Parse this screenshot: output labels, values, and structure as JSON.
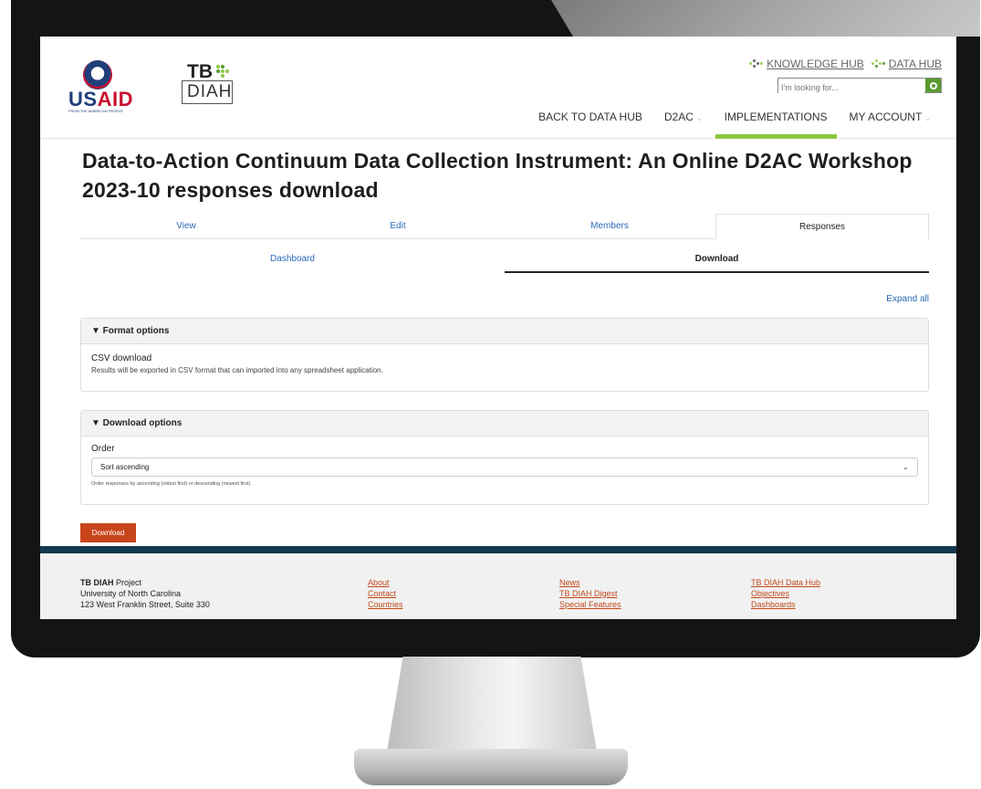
{
  "header": {
    "usaid": {
      "us": "US",
      "aid": "AID",
      "tagline": "FROM THE AMERICAN PEOPLE"
    },
    "tbdiah": {
      "tb": "TB",
      "diah": "DIAH"
    },
    "hub_links": [
      {
        "label": "KNOWLEDGE HUB",
        "icon": "hub-dots-icon"
      },
      {
        "label": "DATA HUB",
        "icon": "hub-dots-icon"
      }
    ],
    "search": {
      "placeholder": "I'm looking for..."
    },
    "nav": [
      {
        "label": "BACK TO DATA HUB"
      },
      {
        "label": "D2AC",
        "caret": "⌄"
      },
      {
        "label": "IMPLEMENTATIONS"
      },
      {
        "label": "MY ACCOUNT",
        "caret": "⌄"
      }
    ],
    "accent_color": "#8cc63f"
  },
  "page": {
    "title": "Data-to-Action Continuum Data Collection Instrument: An Online D2AC Workshop 2023-10 responses download"
  },
  "tabs_primary": [
    "View",
    "Edit",
    "Members",
    "Responses"
  ],
  "tabs_secondary": [
    "Dashboard",
    "Download"
  ],
  "expand_all": "Expand all",
  "format_options": {
    "heading": "▼ Format options",
    "label": "CSV download",
    "description": "Results will be exported in CSV format that can imported into any spreadsheet application."
  },
  "download_options": {
    "heading": "▼ Download options",
    "order_label": "Order",
    "selected": "Sort ascending",
    "hint": "Order responses by ascending (oldest first) or descending (newest first)."
  },
  "download_button": "Download",
  "footer": {
    "org_name": "TB DIAH",
    "org_suffix": " Project",
    "address": [
      "University of North Carolina",
      "123 West Franklin Street, Suite 330"
    ],
    "col2": [
      "About",
      "Contact",
      "Countries"
    ],
    "col3": [
      "News",
      "TB DIAH Digest",
      "Special Features"
    ],
    "col4": [
      "TB DIAH Data Hub",
      "Objectives",
      "Dashboards"
    ]
  }
}
